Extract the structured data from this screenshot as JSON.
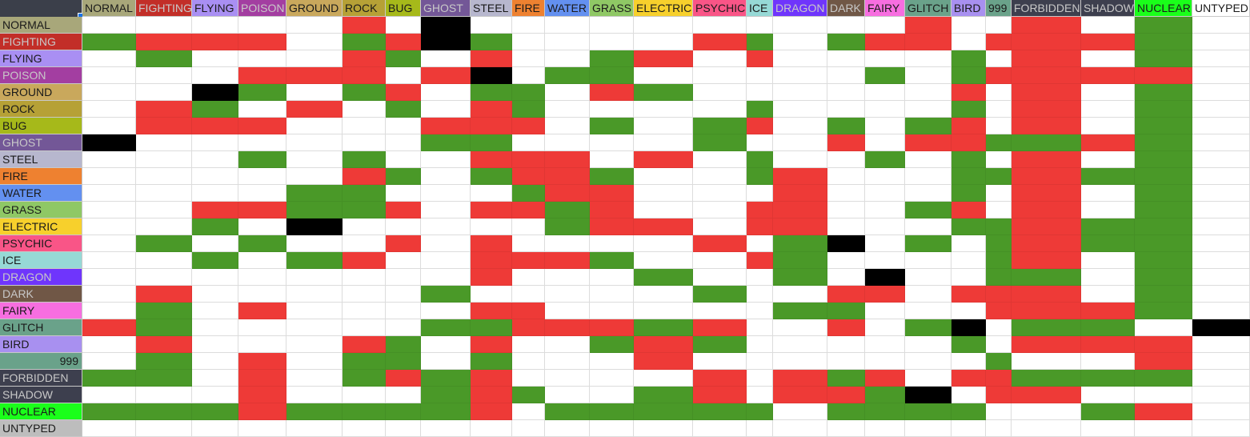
{
  "colors": {
    "weak": "#ee3a37",
    "strong": "#4a9928",
    "immune": "#000000",
    "neutral": "#ffffff"
  },
  "columns": [
    {
      "label": "NORMAL",
      "color": "#a8a77a"
    },
    {
      "label": "FIGHTING",
      "color": "#c22e28"
    },
    {
      "label": "FLYING",
      "color": "#a98ff3"
    },
    {
      "label": "POISON",
      "color": "#a33ea1"
    },
    {
      "label": "GROUND",
      "color": "#c9a85c"
    },
    {
      "label": "ROCK",
      "color": "#b6a136"
    },
    {
      "label": "BUG",
      "color": "#a6b91a"
    },
    {
      "label": "GHOST",
      "color": "#735797"
    },
    {
      "label": "STEEL",
      "color": "#b7b7ce"
    },
    {
      "label": "FIRE",
      "color": "#ee8130"
    },
    {
      "label": "WATER",
      "color": "#6390f0"
    },
    {
      "label": "GRASS",
      "color": "#8fc865"
    },
    {
      "label": "ELECTRIC",
      "color": "#f7d02c"
    },
    {
      "label": "PSYCHIC",
      "color": "#f95587"
    },
    {
      "label": "ICE",
      "color": "#96d9d6"
    },
    {
      "label": "DRAGON",
      "color": "#6f35fc"
    },
    {
      "label": "DARK",
      "color": "#705746"
    },
    {
      "label": "FAIRY",
      "color": "#f76ee0"
    },
    {
      "label": "GLITCH",
      "color": "#6aa28a"
    },
    {
      "label": "BIRD",
      "color": "#a890f0"
    },
    {
      "label": "999",
      "color": "#6aa28a"
    },
    {
      "label": "FORBIDDEN",
      "color": "#3d3f4e"
    },
    {
      "label": "SHADOW",
      "color": "#3d3f4e"
    },
    {
      "label": "NUCLEAR",
      "color": "#1aff1a"
    },
    {
      "label": "UNTYPED",
      "color": "#ffffff"
    }
  ],
  "rows": [
    {
      "label": "NORMAL",
      "color": "#a8a77a",
      "cells": "NNNNNWNINNNNNNNNNNWNNWNSN"
    },
    {
      "label": "FIGHTING",
      "color": "#c22e28",
      "cells": "SWWWNSWISNNNNWSNSWWNWWWSN"
    },
    {
      "label": "FLYING",
      "color": "#a98ff3",
      "cells": "NSNNNWSNWNNSWNWNNNNSNWNSN"
    },
    {
      "label": "POISON",
      "color": "#a33ea1",
      "cells": "NNNWWWNWINSSNNNNNSNSWWWWN"
    },
    {
      "label": "GROUND",
      "color": "#c9a85c",
      "cells": "NNISNSWNSSNWSNNNNNNWNWNSN"
    },
    {
      "label": "ROCK",
      "color": "#b6a136",
      "cells": "NWSNWNSNWSNNNNSNNNNSNWNSN"
    },
    {
      "label": "BUG",
      "color": "#a6b91a",
      "cells": "NWWWNNNWWWNSNSWNSNSWNWNSN"
    },
    {
      "label": "GHOST",
      "color": "#735797",
      "cells": "INNNNNNSSNNNNSNNWNWWSSWSN"
    },
    {
      "label": "STEEL",
      "color": "#b7b7ce",
      "cells": "NNNSNSNNWWWNWNSNNSNSNWNSN"
    },
    {
      "label": "FIRE",
      "color": "#ee8130",
      "cells": "NNNNNWSNSWWSNNSWNNNSSWSSN"
    },
    {
      "label": "WATER",
      "color": "#6390f0",
      "cells": "NNNNSSNNNSWWNNNWNNNSNWNSN"
    },
    {
      "label": "GRASS",
      "color": "#8fc865",
      "cells": "NNWWSSWNWWSWNNWWNNSWNWNSN"
    },
    {
      "label": "ELECTRIC",
      "color": "#f7d02c",
      "cells": "NNSNINNNNNSWWNWWNNNSSWSSN"
    },
    {
      "label": "PSYCHIC",
      "color": "#f95587",
      "cells": "NSNSNNWNWNNNNWNSINSNSWSSN"
    },
    {
      "label": "ICE",
      "color": "#96d9d6",
      "cells": "NNSNSWNNWWWSNNWSNNNNSWNSN"
    },
    {
      "label": "DRAGON",
      "color": "#6f35fc",
      "cells": "NNNNNNNNWNNNSNNSNINNSSNSN"
    },
    {
      "label": "DARK",
      "color": "#705746",
      "cells": "NWNNNNNSNNNNNSNNWWNWWWNSN"
    },
    {
      "label": "FAIRY",
      "color": "#f76ee0",
      "cells": "NSNWNNNNWWNNNNNSSNNNWWWSN"
    },
    {
      "label": "GLITCH",
      "color": "#6aa28a",
      "cells": "WSNNNNNSSWWWSWNNWNSINSSNI"
    },
    {
      "label": "BIRD",
      "color": "#a890f0",
      "cells": "NWNNNWSNWNNSWSNNNNNSNWWWN"
    },
    {
      "label": "999",
      "color": "#6aa28a",
      "cells": "NSNWNSSNSNNNWNNNNNNNSNNWN"
    },
    {
      "label": "FORBIDDEN",
      "color": "#3d3f4e",
      "cells": "SSNWNSWSWNNNNWNWSWNWWSSSN"
    },
    {
      "label": "SHADOW",
      "color": "#3d3f4e",
      "cells": "NNNWNNNSWSNNSWNWWSINWWNNN"
    },
    {
      "label": "NUCLEAR",
      "color": "#1aff1a",
      "cells": "SSSWSSSSWNSSSSSNSSSSNNSWN"
    },
    {
      "label": "UNTYPED",
      "color": "#bdbdbd",
      "cells": "NNNNNNNNNNNNNNNNNNNNNNNNN"
    }
  ]
}
